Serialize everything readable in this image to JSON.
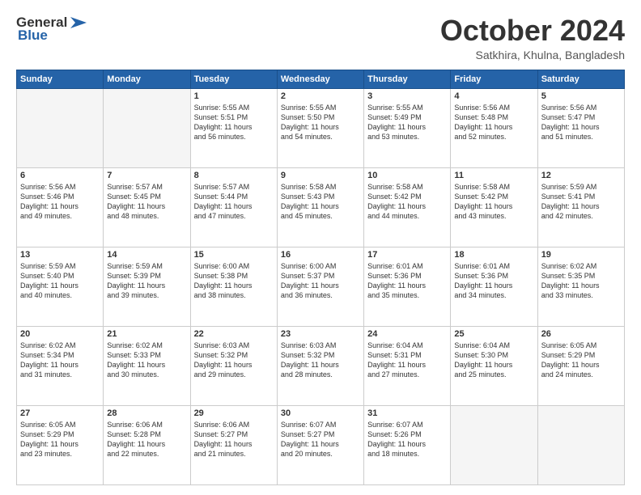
{
  "header": {
    "logo_line1": "General",
    "logo_line2": "Blue",
    "month": "October 2024",
    "location": "Satkhira, Khulna, Bangladesh"
  },
  "days_of_week": [
    "Sunday",
    "Monday",
    "Tuesday",
    "Wednesday",
    "Thursday",
    "Friday",
    "Saturday"
  ],
  "weeks": [
    [
      {
        "day": "",
        "info": ""
      },
      {
        "day": "",
        "info": ""
      },
      {
        "day": "1",
        "info": "Sunrise: 5:55 AM\nSunset: 5:51 PM\nDaylight: 11 hours\nand 56 minutes."
      },
      {
        "day": "2",
        "info": "Sunrise: 5:55 AM\nSunset: 5:50 PM\nDaylight: 11 hours\nand 54 minutes."
      },
      {
        "day": "3",
        "info": "Sunrise: 5:55 AM\nSunset: 5:49 PM\nDaylight: 11 hours\nand 53 minutes."
      },
      {
        "day": "4",
        "info": "Sunrise: 5:56 AM\nSunset: 5:48 PM\nDaylight: 11 hours\nand 52 minutes."
      },
      {
        "day": "5",
        "info": "Sunrise: 5:56 AM\nSunset: 5:47 PM\nDaylight: 11 hours\nand 51 minutes."
      }
    ],
    [
      {
        "day": "6",
        "info": "Sunrise: 5:56 AM\nSunset: 5:46 PM\nDaylight: 11 hours\nand 49 minutes."
      },
      {
        "day": "7",
        "info": "Sunrise: 5:57 AM\nSunset: 5:45 PM\nDaylight: 11 hours\nand 48 minutes."
      },
      {
        "day": "8",
        "info": "Sunrise: 5:57 AM\nSunset: 5:44 PM\nDaylight: 11 hours\nand 47 minutes."
      },
      {
        "day": "9",
        "info": "Sunrise: 5:58 AM\nSunset: 5:43 PM\nDaylight: 11 hours\nand 45 minutes."
      },
      {
        "day": "10",
        "info": "Sunrise: 5:58 AM\nSunset: 5:42 PM\nDaylight: 11 hours\nand 44 minutes."
      },
      {
        "day": "11",
        "info": "Sunrise: 5:58 AM\nSunset: 5:42 PM\nDaylight: 11 hours\nand 43 minutes."
      },
      {
        "day": "12",
        "info": "Sunrise: 5:59 AM\nSunset: 5:41 PM\nDaylight: 11 hours\nand 42 minutes."
      }
    ],
    [
      {
        "day": "13",
        "info": "Sunrise: 5:59 AM\nSunset: 5:40 PM\nDaylight: 11 hours\nand 40 minutes."
      },
      {
        "day": "14",
        "info": "Sunrise: 5:59 AM\nSunset: 5:39 PM\nDaylight: 11 hours\nand 39 minutes."
      },
      {
        "day": "15",
        "info": "Sunrise: 6:00 AM\nSunset: 5:38 PM\nDaylight: 11 hours\nand 38 minutes."
      },
      {
        "day": "16",
        "info": "Sunrise: 6:00 AM\nSunset: 5:37 PM\nDaylight: 11 hours\nand 36 minutes."
      },
      {
        "day": "17",
        "info": "Sunrise: 6:01 AM\nSunset: 5:36 PM\nDaylight: 11 hours\nand 35 minutes."
      },
      {
        "day": "18",
        "info": "Sunrise: 6:01 AM\nSunset: 5:36 PM\nDaylight: 11 hours\nand 34 minutes."
      },
      {
        "day": "19",
        "info": "Sunrise: 6:02 AM\nSunset: 5:35 PM\nDaylight: 11 hours\nand 33 minutes."
      }
    ],
    [
      {
        "day": "20",
        "info": "Sunrise: 6:02 AM\nSunset: 5:34 PM\nDaylight: 11 hours\nand 31 minutes."
      },
      {
        "day": "21",
        "info": "Sunrise: 6:02 AM\nSunset: 5:33 PM\nDaylight: 11 hours\nand 30 minutes."
      },
      {
        "day": "22",
        "info": "Sunrise: 6:03 AM\nSunset: 5:32 PM\nDaylight: 11 hours\nand 29 minutes."
      },
      {
        "day": "23",
        "info": "Sunrise: 6:03 AM\nSunset: 5:32 PM\nDaylight: 11 hours\nand 28 minutes."
      },
      {
        "day": "24",
        "info": "Sunrise: 6:04 AM\nSunset: 5:31 PM\nDaylight: 11 hours\nand 27 minutes."
      },
      {
        "day": "25",
        "info": "Sunrise: 6:04 AM\nSunset: 5:30 PM\nDaylight: 11 hours\nand 25 minutes."
      },
      {
        "day": "26",
        "info": "Sunrise: 6:05 AM\nSunset: 5:29 PM\nDaylight: 11 hours\nand 24 minutes."
      }
    ],
    [
      {
        "day": "27",
        "info": "Sunrise: 6:05 AM\nSunset: 5:29 PM\nDaylight: 11 hours\nand 23 minutes."
      },
      {
        "day": "28",
        "info": "Sunrise: 6:06 AM\nSunset: 5:28 PM\nDaylight: 11 hours\nand 22 minutes."
      },
      {
        "day": "29",
        "info": "Sunrise: 6:06 AM\nSunset: 5:27 PM\nDaylight: 11 hours\nand 21 minutes."
      },
      {
        "day": "30",
        "info": "Sunrise: 6:07 AM\nSunset: 5:27 PM\nDaylight: 11 hours\nand 20 minutes."
      },
      {
        "day": "31",
        "info": "Sunrise: 6:07 AM\nSunset: 5:26 PM\nDaylight: 11 hours\nand 18 minutes."
      },
      {
        "day": "",
        "info": ""
      },
      {
        "day": "",
        "info": ""
      }
    ]
  ]
}
